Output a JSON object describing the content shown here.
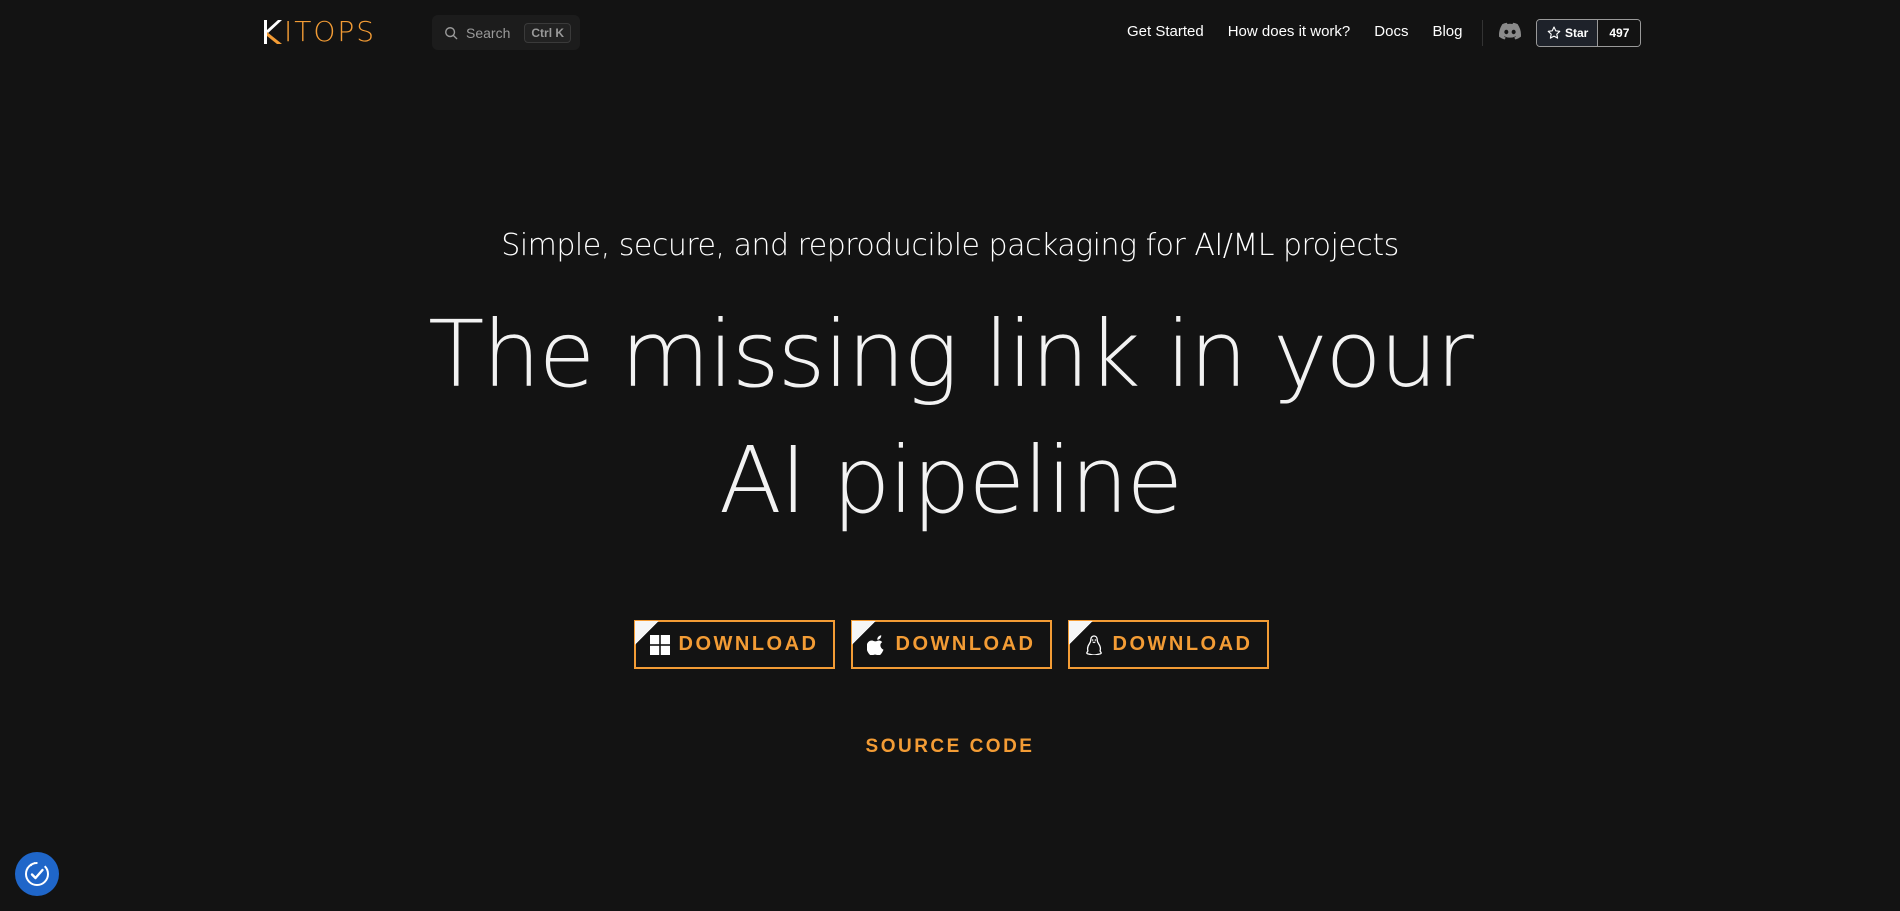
{
  "nav": {
    "logo_text": "ITOPS",
    "logo_mark": "K",
    "search": {
      "label": "Search",
      "shortcut": "Ctrl K"
    },
    "links": [
      "Get Started",
      "How does it work?",
      "Docs",
      "Blog"
    ],
    "discord_icon": "discord-icon",
    "github": {
      "star_label": "Star",
      "count": "497"
    }
  },
  "hero": {
    "tagline": "Simple, secure, and reproducible packaging for AI/ML projects",
    "headline": "The missing link in your AI pipeline",
    "downloads": [
      {
        "os": "windows-icon",
        "label": "DOWNLOAD"
      },
      {
        "os": "apple-icon",
        "label": "DOWNLOAD"
      },
      {
        "os": "linux-icon",
        "label": "DOWNLOAD"
      }
    ],
    "source_label": "SOURCE CODE"
  },
  "colors": {
    "accent": "#f39c35",
    "background": "#131313",
    "consent_button": "#1f66c9"
  },
  "consent_icon": "cookie-consent-icon"
}
